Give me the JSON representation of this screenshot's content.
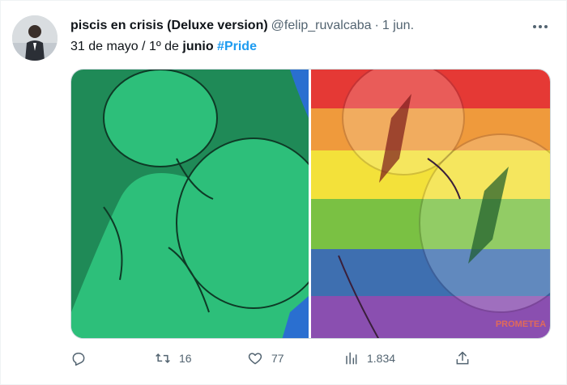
{
  "tweet": {
    "display_name": "piscis en crisis (Deluxe version)",
    "handle": "@felip_ruvalcaba",
    "separator": "·",
    "timestamp": "1 jun.",
    "text_prefix": "31 de mayo / 1º de ",
    "text_bold": "junio",
    "hashtag": "#Pride",
    "watermark": "PROMETEA"
  },
  "actions": {
    "reply": {
      "icon": "reply-icon",
      "count": ""
    },
    "retweet": {
      "icon": "retweet-icon",
      "count": "16"
    },
    "like": {
      "icon": "heart-icon",
      "count": "77"
    },
    "views": {
      "icon": "views-icon",
      "count": "1.834"
    },
    "share": {
      "icon": "share-icon",
      "count": ""
    }
  },
  "colors": {
    "green_dark": "#1f8a57",
    "green_light": "#2dbf7a",
    "rainbow": [
      "#e53935",
      "#ef9a3c",
      "#f3e13a",
      "#7ac143",
      "#3e6fb0",
      "#8a4fb0"
    ],
    "link": "#1d9bf0",
    "muted": "#536471"
  }
}
